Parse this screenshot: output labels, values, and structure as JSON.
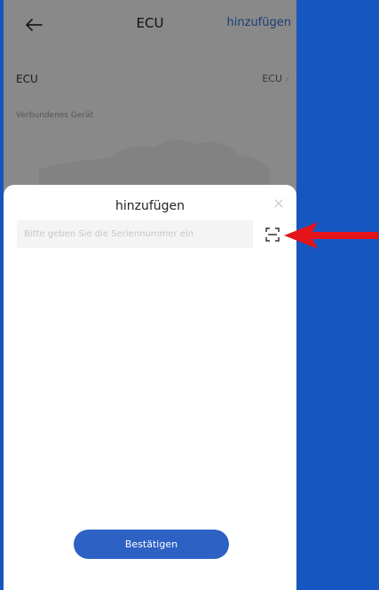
{
  "header": {
    "title": "ECU",
    "action_label": "hinzufügen"
  },
  "ecu_row": {
    "label": "ECU",
    "value": "ECU"
  },
  "connected_label": "Verbundenes Gerät",
  "sheet": {
    "title": "hinzufügen",
    "serial_placeholder": "Bitte geben Sie die Seriennummer ein",
    "serial_value": "",
    "confirm_label": "Bestätigen"
  },
  "colors": {
    "background_blue": "#1556c0",
    "accent": "#2f6fd6",
    "button": "#2d61c4",
    "annotation_arrow": "#e4141b"
  },
  "icons": {
    "back": "arrow-left-icon",
    "chevron": "chevron-right-icon",
    "close": "close-icon",
    "scan": "scan-icon",
    "annotation": "red-arrow-icon"
  }
}
